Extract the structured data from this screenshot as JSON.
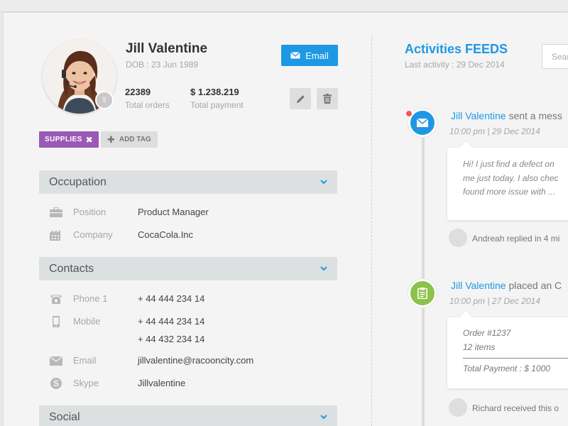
{
  "profile": {
    "name": "Jill Valentine",
    "dob": "DOB : 23 Jun 1989",
    "total_orders_value": "22389",
    "total_orders_label": "Total orders",
    "total_payment_value": "$ 1.238.219",
    "total_payment_label": "Total payment",
    "email_button": "Email",
    "gender_symbol": "♀"
  },
  "tags": {
    "items": [
      {
        "label": "SUPPLIES",
        "color": "#9b59b6"
      }
    ],
    "add_label": "ADD TAG"
  },
  "sections": {
    "occupation": {
      "title": "Occupation",
      "rows": [
        {
          "icon": "briefcase-icon",
          "label": "Position",
          "value": "Product Manager"
        },
        {
          "icon": "building-icon",
          "label": "Company",
          "value": "CocaCola.Inc"
        }
      ]
    },
    "contacts": {
      "title": "Contacts",
      "rows": [
        {
          "icon": "phone-icon",
          "label": "Phone 1",
          "value": "+ 44 444 234 14"
        },
        {
          "icon": "mobile-icon",
          "label": "Mobile",
          "value": "+ 44 444 234 14",
          "value2": "+ 44 432 234 14"
        },
        {
          "icon": "envelope-icon",
          "label": "Email",
          "value": "jillvalentine@racooncity.com"
        },
        {
          "icon": "skype-icon",
          "label": "Skype",
          "value": "Jillvalentine"
        }
      ]
    },
    "social": {
      "title": "Social"
    }
  },
  "feed": {
    "title": "Activities FEEDS",
    "last_activity": "Last activity :  29 Dec 2014",
    "search_placeholder": "Sear",
    "items": [
      {
        "icon": "envelope-icon",
        "color": "#1e98e5",
        "who": "Jill Valentine",
        "action": "sent a mess",
        "time": "10:00 pm  |  29 Dec 2014",
        "message": [
          "Hi! I just find a defect on",
          "me just today. I also chec",
          "found more issue with  ..."
        ],
        "reply": "Andreah replied in 4 mi"
      },
      {
        "icon": "clipboard-icon",
        "color": "#8bc34a",
        "who": "Jill Valentine",
        "action": "placed an C",
        "time": "10:00 pm  |  27 Dec 2014",
        "order_number": "Order #1237",
        "order_items": "12 items",
        "order_total": "Total Payment : $ 1000",
        "reply": "Richard received this o"
      }
    ]
  },
  "colors": {
    "accent": "#1e98e5",
    "tag": "#9b59b6",
    "order": "#8bc34a",
    "notification": "#f05a5a"
  }
}
